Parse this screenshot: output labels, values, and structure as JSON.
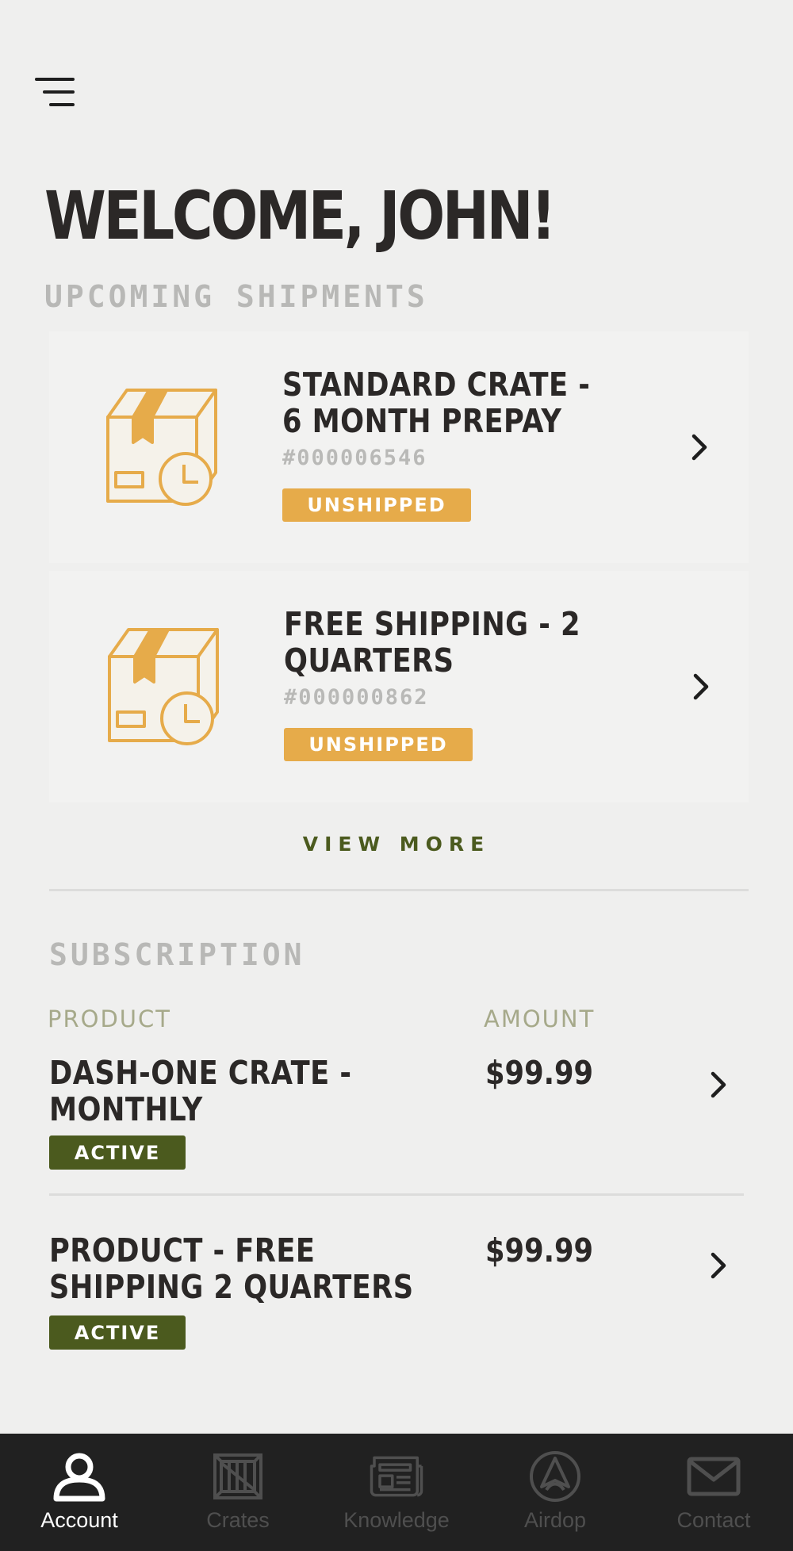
{
  "header": {
    "menu_icon": "hamburger-menu-icon",
    "welcome": "WELCOME, JOHN!"
  },
  "upcoming": {
    "title": "UPCOMING SHIPMENTS",
    "items": [
      {
        "name": "STANDARD CRATE - 6 MONTH PREPAY",
        "number": "#000006546",
        "status": "UNSHIPPED",
        "icon": "box-clock-icon"
      },
      {
        "name": "FREE SHIPPING - 2 QUARTERS",
        "number": "#000000862",
        "status": "UNSHIPPED",
        "icon": "box-clock-icon"
      }
    ],
    "view_more": "VIEW MORE"
  },
  "subscription": {
    "title": "SUBSCRIPTION",
    "col_product": "PRODUCT",
    "col_amount": "AMOUNT",
    "items": [
      {
        "name": "DASH-ONE CRATE - MONTHLY",
        "amount": "$99.99",
        "status": "ACTIVE"
      },
      {
        "name": "PRODUCT - FREE SHIPPING 2 QUARTERS",
        "amount": "$99.99",
        "status": "ACTIVE"
      }
    ]
  },
  "tabbar": {
    "active": "Account",
    "tabs": [
      {
        "label": "Account",
        "icon": "person-icon"
      },
      {
        "label": "Crates",
        "icon": "crate-icon"
      },
      {
        "label": "Knowledge",
        "icon": "newspaper-icon"
      },
      {
        "label": "Airdop",
        "icon": "airdrop-icon"
      },
      {
        "label": "Contact",
        "icon": "mail-icon"
      }
    ]
  },
  "colors": {
    "background": "#efefee",
    "accent_gold": "#e6ab4a",
    "accent_olive": "#4b5a1e",
    "text_dark": "#2b2827",
    "tabbar_bg": "#212121"
  }
}
